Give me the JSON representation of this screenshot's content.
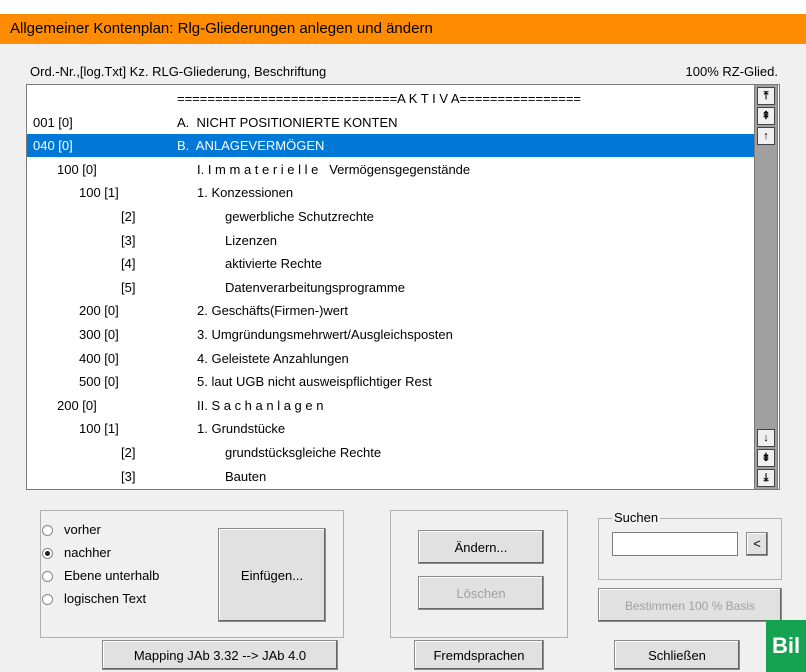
{
  "window": {
    "title": "Allgemeiner Kontenplan: Rlg-Gliederungen anlegen und ändern"
  },
  "header": {
    "left": "Ord.-Nr.,[log.Txt] Kz. RLG-Gliederung, Beschriftung",
    "right": "100% RZ-Glied."
  },
  "rows": [
    {
      "ord": "",
      "text": "=============================A K T I V A================",
      "selected": false
    },
    {
      "ord": "001 [0]",
      "text": "A.  NICHT POSITIONIERTE KONTEN",
      "selected": false
    },
    {
      "ord": "040 [0]",
      "text": "B.  ANLAGEVERMÖGEN",
      "selected": true
    },
    {
      "ord": "100 [0]",
      "text": "I. I m m a t e r i e l l e   Vermögensgegenstände",
      "selected": false
    },
    {
      "ord": "100 [1]",
      "text": "1. Konzessionen",
      "selected": false
    },
    {
      "ord": "[2]",
      "text": "gewerbliche Schutzrechte",
      "selected": false
    },
    {
      "ord": "[3]",
      "text": "Lizenzen",
      "selected": false
    },
    {
      "ord": "[4]",
      "text": "aktivierte Rechte",
      "selected": false
    },
    {
      "ord": "[5]",
      "text": "Datenverarbeitungsprogramme",
      "selected": false
    },
    {
      "ord": "200 [0]",
      "text": "2. Geschäfts(Firmen-)wert",
      "selected": false
    },
    {
      "ord": "300 [0]",
      "text": "3. Umgründungsmehrwert/Ausgleichsposten",
      "selected": false
    },
    {
      "ord": "400 [0]",
      "text": "4. Geleistete Anzahlungen",
      "selected": false
    },
    {
      "ord": "500 [0]",
      "text": "5. laut UGB nicht ausweispflichtiger Rest",
      "selected": false
    },
    {
      "ord": "200 [0]",
      "text": "II. S a c h a n l a g e n",
      "selected": false
    },
    {
      "ord": "100 [1]",
      "text": "1. Grundstücke",
      "selected": false
    },
    {
      "ord": "[2]",
      "text": "grundstücksgleiche Rechte",
      "selected": false
    },
    {
      "ord": "[3]",
      "text": "Bauten",
      "selected": false
    }
  ],
  "radios": [
    {
      "label": "vorher",
      "checked": false
    },
    {
      "label": "nachher",
      "checked": true
    },
    {
      "label": "Ebene unterhalb",
      "checked": false
    },
    {
      "label": "logischen Text",
      "checked": false
    }
  ],
  "buttons": {
    "insert": "Einfügen...",
    "change": "Ändern...",
    "delete": "Löschen",
    "determine": "Bestimmen 100 % Basis",
    "mapping": "Mapping JAb 3.32 --> JAb 4.0",
    "foreign": "Fremdsprachen",
    "close": "Schließen",
    "search_go": "<"
  },
  "search": {
    "label": "Suchen",
    "value": ""
  },
  "logo": {
    "text": "Bil"
  },
  "scroll_icons": [
    "scroll-top-icon",
    "page-up-icon",
    "line-up-icon",
    "line-down-icon",
    "page-down-icon",
    "scroll-bottom-icon"
  ]
}
